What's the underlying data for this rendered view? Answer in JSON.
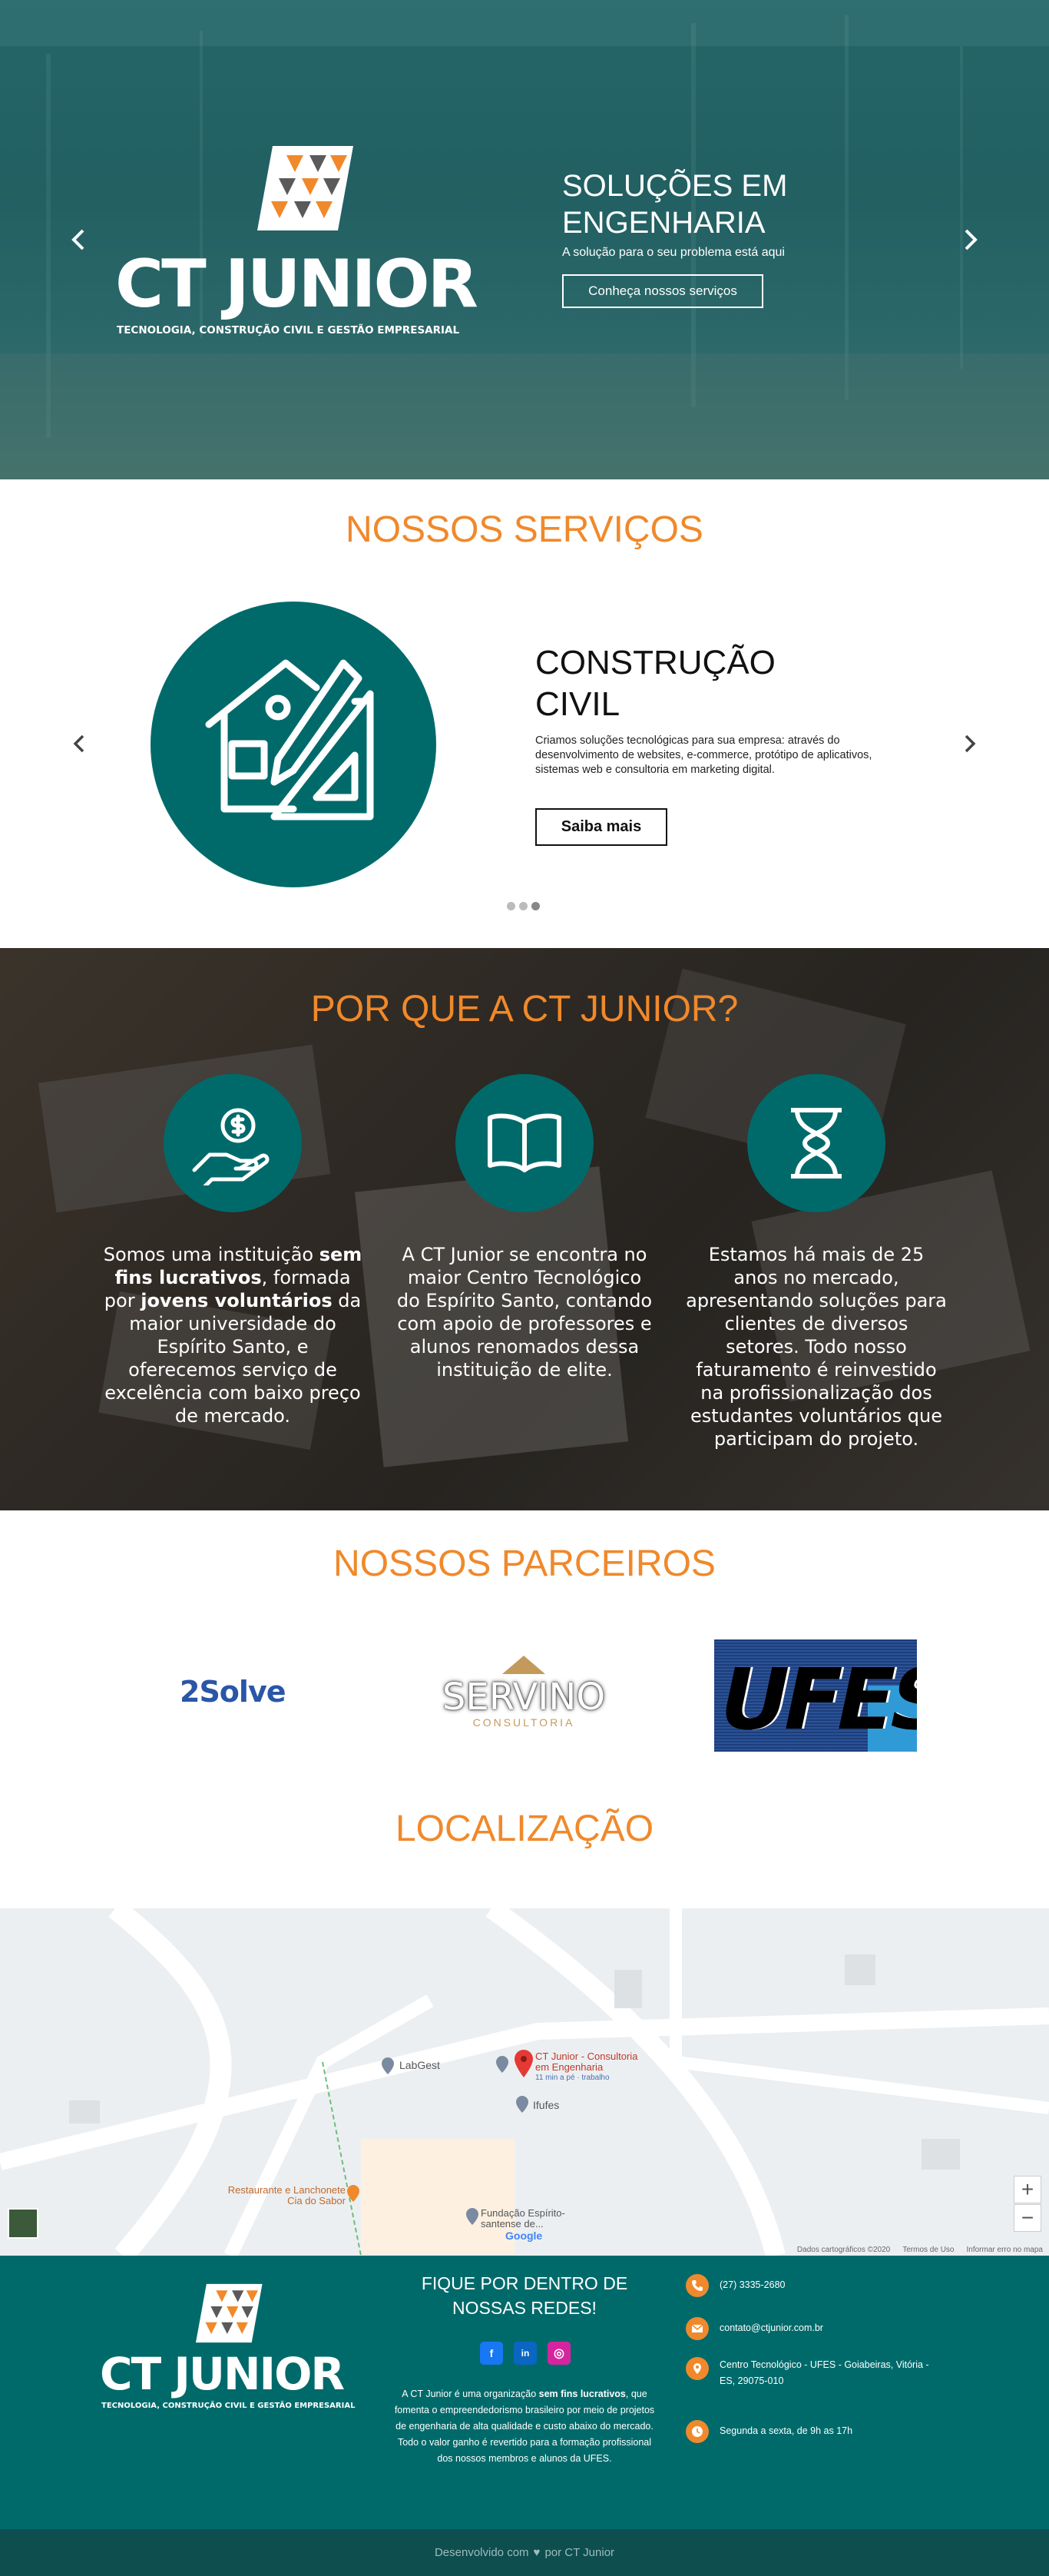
{
  "hero": {
    "logo_text": "CT JUNIOR",
    "logo_subtitle": "TECNOLOGIA, CONSTRUÇÃO CIVIL E GESTÃO EMPRESARIAL",
    "title": "SOLUÇÕES EM ENGENHARIA",
    "subtitle": "A solução para o seu problema está aqui",
    "button_label": "Conheça nossos serviços"
  },
  "services": {
    "title": "NOSSOS SERVIÇOS",
    "item_title": "CONSTRUÇÃO CIVIL",
    "item_description": "Criamos soluções tecnológicas para sua empresa: através do desenvolvimento de websites, e-commerce, protótipo de aplicativos, sistemas web e consultoria em marketing digital.",
    "button_label": "Saiba mais",
    "slide_count": 3,
    "active_slide": 3
  },
  "why": {
    "title": "POR QUE A CT JUNIOR?",
    "col1": {
      "t1": "Somos uma instituição ",
      "b1": "sem fins lucrativos",
      "t2": ", formada por ",
      "b2": "jovens voluntários",
      "t3": " da maior universidade do Espírito Santo, e oferecemos serviço de excelência com baixo preço de mercado."
    },
    "col2": "A CT Junior se encontra no maior Centro Tecnológico do Espírito Santo, contando com apoio de professores e alunos renomados dessa instituição de elite.",
    "col3": "Estamos há mais de 25 anos no mercado, apresentando soluções para clientes de diversos setores. Todo nosso faturamento é reinvestido na profissionalização dos estudantes voluntários que participam do projeto."
  },
  "partners": {
    "title": "NOSSOS PARCEIROS",
    "p1": "2Solve",
    "p2_main": "SERVINO",
    "p2_sub": "CONSULTORIA",
    "p3": "UFES"
  },
  "location": {
    "title": "LOCALIZAÇÃO",
    "map": {
      "pin_label": "CT Junior - Consultoria em Engenharia",
      "pin_sub": "11 min a pé · trabalho",
      "labgest": "LabGest",
      "ifufes": "Ifufes",
      "restaurant": "Restaurante e Lanchonete Cia do Sabor",
      "fundacao": "Fundação Espírito-santense de...",
      "google": "Google",
      "zoom_in": "+",
      "zoom_out": "−",
      "attrib1": "Dados cartográficos ©2020",
      "attrib2": "Termos de Uso",
      "attrib3": "Informar erro no mapa"
    }
  },
  "footer": {
    "logo_text": "CT JUNIOR",
    "logo_subtitle": "TECNOLOGIA, CONSTRUÇÃO CIVIL E GESTÃO EMPRESARIAL",
    "heading": "FIQUE POR DENTRO DE NOSSAS REDES!",
    "social_facebook": "f",
    "social_linkedin": "in",
    "social_instagram": "◎",
    "about_t1": "A CT Junior é uma organização ",
    "about_b1": "sem fins lucrativos",
    "about_t2": ", que fomenta o empreendedorismo brasileiro por meio de projetos de engenharia de alta qualidade e custo abaixo do mercado. Todo o valor ganho é revertido para a formação profissional dos nossos membros e alunos da UFES.",
    "phone": "(27) 3335-2680",
    "email": "contato@ctjunior.com.br",
    "address": "Centro Tecnológico - UFES - Goiabeiras, Vitória - ES, 29075-010",
    "hours": "Segunda a sexta, de 9h as 17h",
    "credit_pre": "Desenvolvido com",
    "credit_post": "por CT Junior"
  },
  "colors": {
    "teal": "#006a6b",
    "orange": "#f0892b"
  }
}
